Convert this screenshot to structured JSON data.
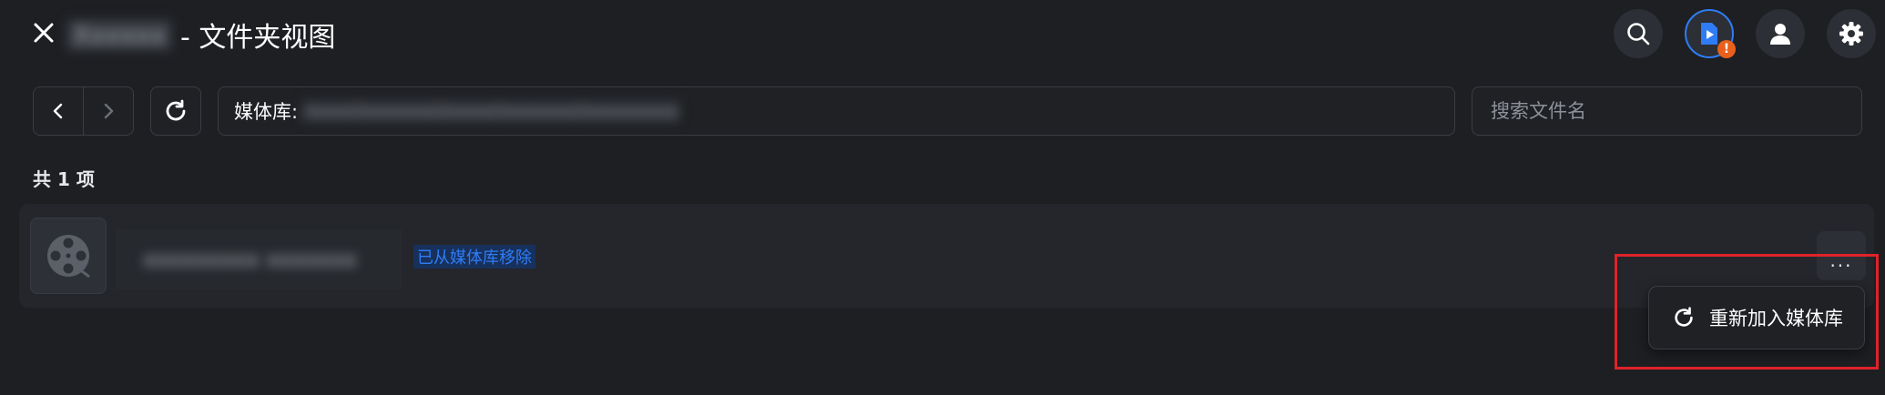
{
  "header": {
    "close_icon": "close-icon",
    "title_prefix_blurred": "Xxxxxx",
    "title": "- 文件夹视图",
    "icons": [
      "search-icon",
      "video-play-icon",
      "user-icon",
      "gear-icon"
    ],
    "alert_badge": "!"
  },
  "toolbar": {
    "library_label": "媒体库:",
    "library_path_blurred": "/xxxx/xxxxxxx/xxxxx/xxxxxxx/xxxxxxxxx",
    "search_placeholder": "搜索文件名"
  },
  "list": {
    "count_label": "共 1 项",
    "items": [
      {
        "name_blurred": "xxxxxxxxx xxxxxxx",
        "tag": "已从媒体库移除"
      }
    ]
  },
  "context_menu": {
    "more_glyph": "···",
    "readd_label": "重新加入媒体库"
  },
  "colors": {
    "accent_blue": "#2f7cf6",
    "badge_orange": "#e8601c",
    "highlight_red": "#e0222a"
  }
}
